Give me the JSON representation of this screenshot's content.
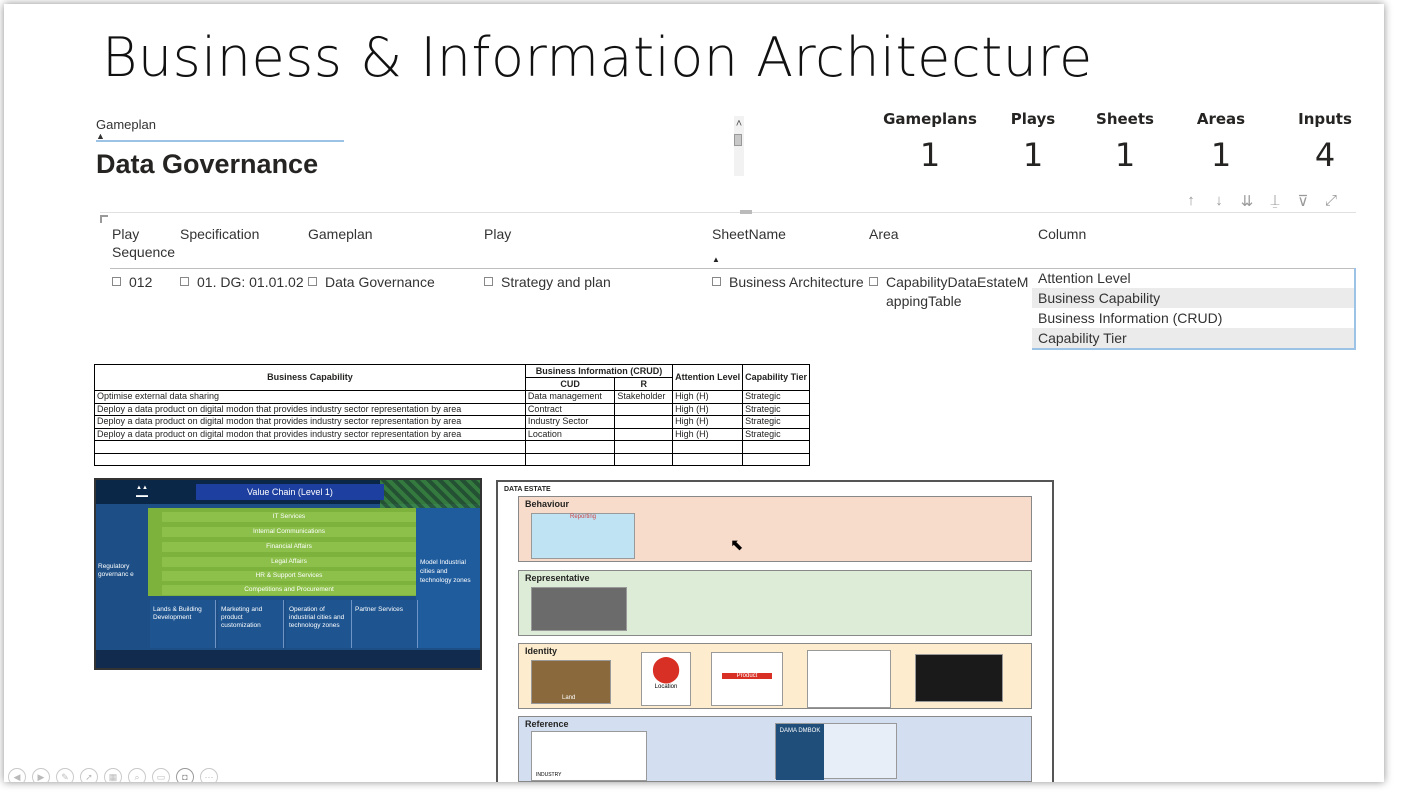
{
  "slide_title": "Business & Information Architecture",
  "slicer": {
    "label": "Gameplan",
    "value": "Data Governance"
  },
  "kpis": [
    {
      "label": "Gameplans",
      "value": "1"
    },
    {
      "label": "Plays",
      "value": "1"
    },
    {
      "label": "Sheets",
      "value": "1"
    },
    {
      "label": "Areas",
      "value": "1"
    },
    {
      "label": "Inputs",
      "value": "4"
    }
  ],
  "visual_header_icons": [
    "arrow-up-icon",
    "arrow-down-icon",
    "expand-all-icon",
    "drill-icon",
    "filter-icon",
    "focus-mode-icon"
  ],
  "matrix": {
    "headers": [
      "Play Sequence",
      "Specification",
      "Gameplan",
      "Play",
      "SheetName",
      "Area",
      "Column"
    ],
    "row": {
      "play_sequence": "012",
      "specification": "01. DG: 01.01.02",
      "gameplan": "Data Governance",
      "play": "Strategy and plan",
      "sheetname": "Business Architecture",
      "area": "CapabilityDataEstateMappingTable",
      "columns": [
        "Attention Level",
        "Business Capability",
        "Business Information (CRUD)",
        "Capability Tier"
      ]
    }
  },
  "excel_table": {
    "headers": {
      "business_capability": "Business Capability",
      "business_information": "Business Information (CRUD)",
      "cud": "CUD",
      "r": "R",
      "attention_level": "Attention Level",
      "capability_tier": "Capability Tier"
    },
    "rows": [
      [
        "Optimise external data sharing",
        "Data management",
        "Stakeholder",
        "High (H)",
        "Strategic"
      ],
      [
        "Deploy a data product on digital modon that provides industry sector representation by area",
        "Contract",
        "",
        "High (H)",
        "Strategic"
      ],
      [
        "Deploy a data product on digital modon that provides industry sector representation by area",
        "Industry Sector",
        "",
        "High (H)",
        "Strategic"
      ],
      [
        "Deploy a data product on digital modon that provides industry sector representation by area",
        "Location",
        "",
        "High (H)",
        "Strategic"
      ],
      [
        "",
        "",
        "",
        "",
        ""
      ],
      [
        "",
        "",
        "",
        "",
        ""
      ]
    ]
  },
  "value_chain": {
    "title": "Value Chain (Level 1)",
    "support_rows": [
      "IT Services",
      "Internal Communications",
      "Financial Affairs",
      "Legal Affairs",
      "HR & Support Services",
      "Competitions and Procurement"
    ],
    "left": "Regulatory governanc e",
    "right": "Model Industrial cities and technology zones",
    "primary": [
      "Lands & Building Development",
      "Marketing and product customization",
      "Operation of industrial cities and technology zones",
      "Partner Services"
    ]
  },
  "data_estate": {
    "title": "DATA ESTATE",
    "bands": [
      {
        "label": "Behaviour",
        "color": "#f8dccb"
      },
      {
        "label": "Representative",
        "color": "#dcecd6"
      },
      {
        "label": "Identity",
        "color": "#fdeccd"
      },
      {
        "label": "Reference",
        "color": "#d3dff0"
      }
    ],
    "thumb_labels": {
      "reporting": "Reporting",
      "land": "Land",
      "location": "Location",
      "product": "Product",
      "industry": "INDUSTRY",
      "dama": "DAMA DMBOK"
    }
  }
}
